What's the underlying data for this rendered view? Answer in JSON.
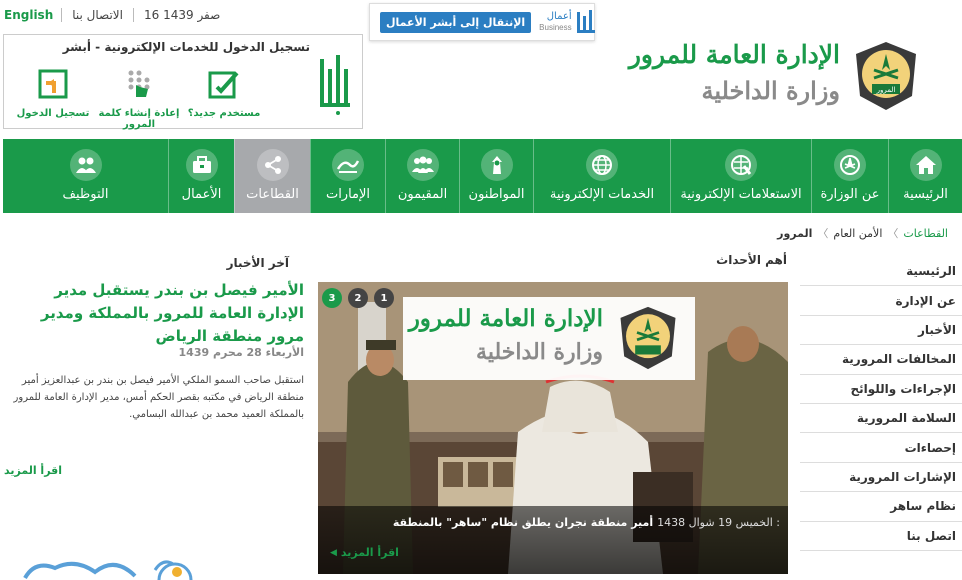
{
  "top_bar": {
    "lang": "English",
    "contact": "الاتصال بنا",
    "date": "16 صفر 1439"
  },
  "business": {
    "button": "الإنتقال إلى أبشر الأعمال",
    "logo_ar": "أعمال",
    "logo_en": "Business"
  },
  "absher": {
    "title": "تسجيل الدخول للخدمات الإلكترونية - أبشر",
    "new_user": "مستخدم جديد؟",
    "reset_password": "إعادة إنشاء كلمة المرور",
    "login": "تسجيل الدخول"
  },
  "brand": {
    "line1": "الإدارة العامة للمرور",
    "line2": "وزارة الداخلية",
    "emblem_text": "المرور"
  },
  "nav": [
    {
      "label": "الرئيسية",
      "icon": "home-icon"
    },
    {
      "label": "عن الوزارة",
      "icon": "ministry-emblem-icon"
    },
    {
      "label": "الاستعلامات الإلكترونية",
      "icon": "globe-inquiry-icon"
    },
    {
      "label": "الخدمات الإلكترونية",
      "icon": "globe-icon"
    },
    {
      "label": "المواطنون",
      "icon": "citizen-icon"
    },
    {
      "label": "المقيمون",
      "icon": "residents-icon"
    },
    {
      "label": "الإمارات",
      "icon": "emirates-icon"
    },
    {
      "label": "القطاعات",
      "icon": "share-network-icon",
      "active": true
    },
    {
      "label": "الأعمال",
      "icon": "briefcase-icon"
    },
    {
      "label": "التوظيف",
      "icon": "people-icon"
    }
  ],
  "breadcrumb": [
    "القطاعات",
    "الأمن العام",
    "المرور"
  ],
  "sections": {
    "latest_news": "آخر الأخبار",
    "top_events": "أهم الأحداث"
  },
  "sidebar": [
    "الرئيسية",
    "عن الإدارة",
    "الأخبار",
    "المخالفات المرورية",
    "الإجراءات واللوائح",
    "السلامة المرورية",
    "إحصاءات",
    "الإشارات المرورية",
    "نظام ساهر",
    "اتصل بنا"
  ],
  "news": {
    "title": "الأمير فيصل بن بندر يستقبل مدير الإدارة العامة للمرور بالمملكة ومدير مرور منطقة الرياض",
    "date": "الأربعاء 28 محرم 1439",
    "body": "استقبل صاحب السمو الملكي الأمير فيصل بن بندر بن عبدالعزيز أمير منطقة الرياض في مكتبه بقصر الحكم أمس، مدير الإدارة العامة للمرور بالمملكة العميد محمد بن عبدالله البسامي.",
    "read_more": "اقرأ المزيد"
  },
  "featured": {
    "slides": [
      "1",
      "2",
      "3"
    ],
    "active_slide": "3",
    "date": "الخميس 19 شوال 1438 :",
    "title": "أمير منطقة نجران يطلق نظام \"ساهر\" بالمنطقة",
    "read_more": "اقرأ المزيد"
  },
  "colors": {
    "primary_green": "#1a9a4a",
    "active_gray": "#a7a9ac",
    "business_blue": "#2b7ec2"
  }
}
